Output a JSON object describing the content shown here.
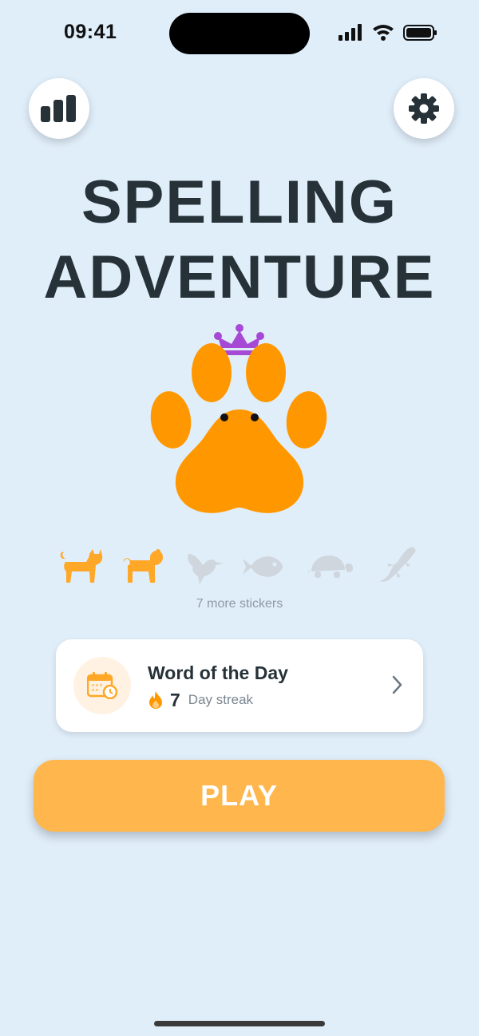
{
  "status_bar": {
    "time": "09:41"
  },
  "header": {
    "stats_icon": "bar-chart-icon",
    "settings_icon": "gear-icon"
  },
  "title": {
    "line1": "SPELLING",
    "line2": "ADVENTURE"
  },
  "mascot": {
    "icon": "paw-with-crown",
    "paw_color": "#ff9800",
    "crown_color": "#a64ad6"
  },
  "stickers": {
    "items": [
      {
        "icon": "cat-icon",
        "unlocked": true
      },
      {
        "icon": "dog-icon",
        "unlocked": true
      },
      {
        "icon": "hummingbird-icon",
        "unlocked": false
      },
      {
        "icon": "fish-icon",
        "unlocked": false
      },
      {
        "icon": "turtle-icon",
        "unlocked": false
      },
      {
        "icon": "lizard-icon",
        "unlocked": false
      }
    ],
    "more_label": "7 more stickers"
  },
  "word_of_day": {
    "title": "Word of the Day",
    "streak_count": "7",
    "streak_label": "Day streak",
    "icon": "calendar-clock-icon"
  },
  "play_button": {
    "label": "PLAY"
  },
  "colors": {
    "background": "#e0eefa",
    "accent": "#ffb74d",
    "primary_text": "#263238",
    "sticker_locked": "#cfd6dd",
    "sticker_unlocked": "#ffa726"
  }
}
